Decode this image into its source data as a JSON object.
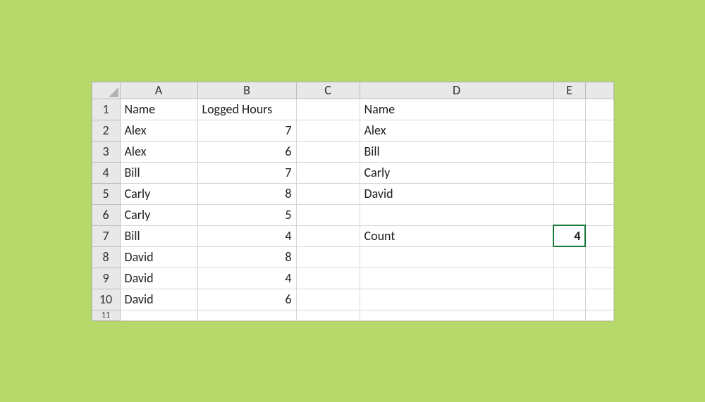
{
  "columns": {
    "A": "A",
    "B": "B",
    "C": "C",
    "D": "D",
    "E": "E"
  },
  "rows": {
    "r1": "1",
    "r2": "2",
    "r3": "3",
    "r4": "4",
    "r5": "5",
    "r6": "6",
    "r7": "7",
    "r8": "8",
    "r9": "9",
    "r10": "10",
    "r11": "11"
  },
  "colors": {
    "greenFill": "#a9d08e",
    "activeBorder": "#1a7a3c",
    "pageBg": "#b7d86a"
  },
  "active_cell": "E7",
  "selected_column": "E",
  "selected_row": "7",
  "grid": {
    "A1": "Name",
    "B1": "Logged Hours",
    "D1": "Name",
    "A2": "Alex",
    "B2": "7",
    "D2": "Alex",
    "A3": "Alex",
    "B3": "6",
    "D3": "Bill",
    "A4": "Bill",
    "B4": "7",
    "D4": "Carly",
    "A5": "Carly",
    "B5": "8",
    "D5": "David",
    "A6": "Carly",
    "B6": "5",
    "A7": "Bill",
    "B7": "4",
    "D7": "Count",
    "E7": "4",
    "A8": "David",
    "B8": "8",
    "A9": "David",
    "B9": "4",
    "A10": "David",
    "B10": "6"
  }
}
